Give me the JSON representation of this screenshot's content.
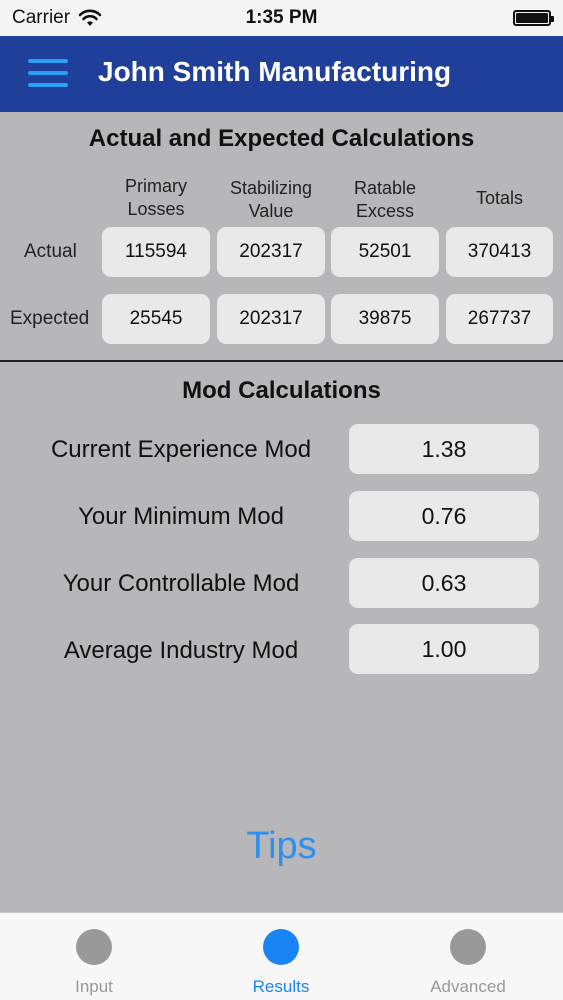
{
  "status_bar": {
    "carrier": "Carrier",
    "time": "1:35 PM"
  },
  "nav": {
    "title": "John Smith Manufacturing"
  },
  "calculations": {
    "title": "Actual and Expected Calculations",
    "columns": [
      {
        "line1": "Primary",
        "line2": "Losses"
      },
      {
        "line1": "Stabilizing",
        "line2": "Value"
      },
      {
        "line1": "Ratable",
        "line2": "Excess"
      },
      {
        "line1": "Totals",
        "line2": ""
      }
    ],
    "rows": [
      {
        "label": "Actual",
        "values": [
          "115594",
          "202317",
          "52501",
          "370413"
        ]
      },
      {
        "label": "Expected",
        "values": [
          "25545",
          "202317",
          "39875",
          "267737"
        ]
      }
    ]
  },
  "mod": {
    "title": "Mod Calculations",
    "rows": [
      {
        "label": "Current Experience Mod",
        "value": "1.38"
      },
      {
        "label": "Your Minimum Mod",
        "value": "0.76"
      },
      {
        "label": "Your Controllable Mod",
        "value": "0.63"
      },
      {
        "label": "Average Industry Mod",
        "value": "1.00"
      }
    ]
  },
  "tips": {
    "label": "Tips"
  },
  "tab_bar": {
    "tabs": [
      {
        "label": "Input",
        "icon": "circle-icon",
        "selected": false
      },
      {
        "label": "Results",
        "icon": "circle-icon",
        "selected": true
      },
      {
        "label": "Advanced",
        "icon": "circle-icon",
        "selected": false
      }
    ]
  },
  "colors": {
    "nav_background": "#1f3f9b",
    "accent": "#2d8ff0",
    "tab_inactive": "#999999",
    "content_background": "#b7b7b9"
  }
}
